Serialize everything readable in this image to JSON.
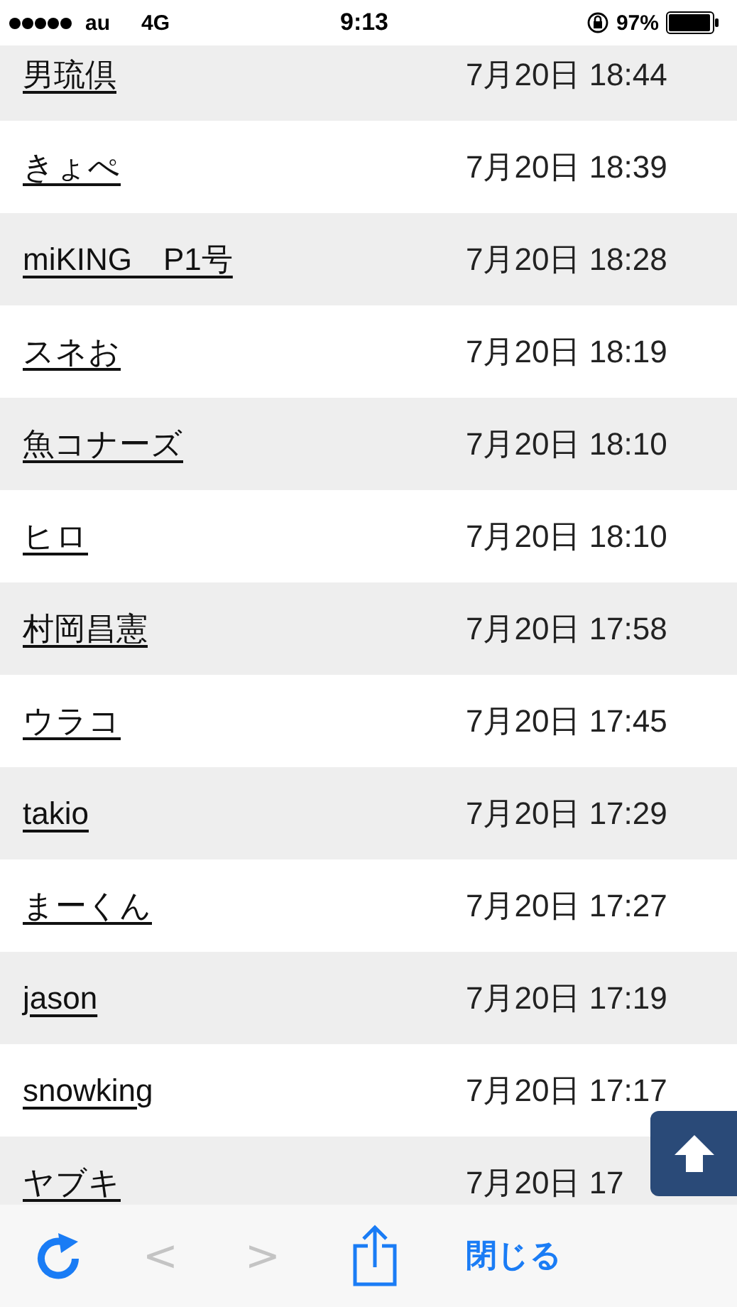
{
  "status_bar": {
    "carrier": "au",
    "network": "4G",
    "time": "9:13",
    "battery": "97%"
  },
  "rows": [
    {
      "name": "男琉倶",
      "time": "7月20日 18:44"
    },
    {
      "name": "きょぺ",
      "time": "7月20日 18:39"
    },
    {
      "name": "miKING　P1号",
      "time": "7月20日 18:28"
    },
    {
      "name": "スネお",
      "time": "7月20日 18:19"
    },
    {
      "name": "魚コナーズ",
      "time": "7月20日 18:10"
    },
    {
      "name": "ヒロ",
      "time": "7月20日 18:10"
    },
    {
      "name": "村岡昌憲",
      "time": "7月20日 17:58"
    },
    {
      "name": "ウラコ",
      "time": "7月20日 17:45"
    },
    {
      "name": "takio",
      "time": "7月20日 17:29"
    },
    {
      "name": "まーくん",
      "time": "7月20日 17:27"
    },
    {
      "name": "jason",
      "time": "7月20日 17:19"
    },
    {
      "name": "snowking",
      "time": "7月20日 17:17"
    },
    {
      "name": "ヤブキ",
      "time": "7月20日 17"
    }
  ],
  "toolbar": {
    "back": {
      "label": "<",
      "disabled": true
    },
    "forward": {
      "label": ">",
      "disabled": true
    },
    "close": "閉じる"
  }
}
